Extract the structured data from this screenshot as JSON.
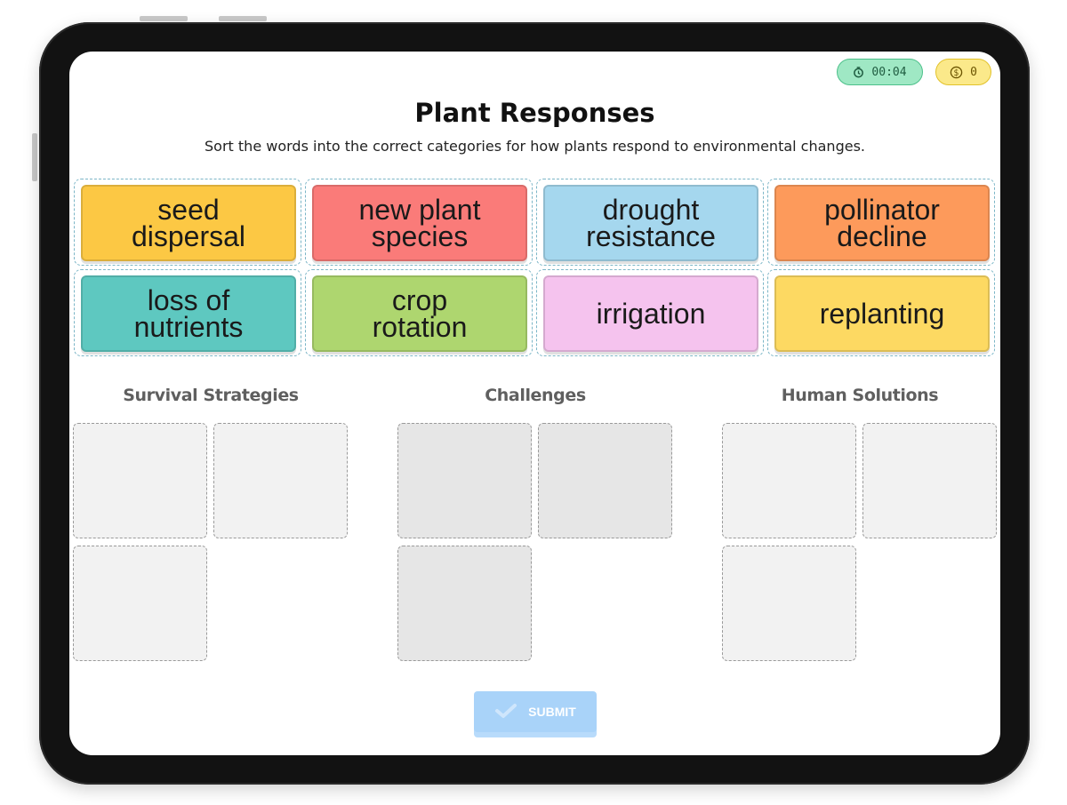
{
  "status": {
    "timer": "00:04",
    "coins": "0",
    "timer_icon": "timer-icon",
    "coin_icon": "dollar-coin-icon"
  },
  "header": {
    "title": "Plant Responses",
    "subtitle": "Sort the words into the correct categories for how plants respond to environmental changes."
  },
  "word_bank": [
    {
      "line1": "seed",
      "line2": "dispersal",
      "color": "#fcc844"
    },
    {
      "line1": "new plant",
      "line2": "species",
      "color": "#fa7b79"
    },
    {
      "line1": "drought",
      "line2": "resistance",
      "color": "#a5d7ee"
    },
    {
      "line1": "pollinator",
      "line2": "decline",
      "color": "#fd9a5b"
    },
    {
      "line1": "loss of",
      "line2": "nutrients",
      "color": "#5ec8c0"
    },
    {
      "line1": "crop",
      "line2": "rotation",
      "color": "#aed66f"
    },
    {
      "line1": "irrigation",
      "line2": "",
      "color": "#f5c3ee"
    },
    {
      "line1": "replanting",
      "line2": "",
      "color": "#fdd962"
    }
  ],
  "categories": [
    {
      "title": "Survival Strategies"
    },
    {
      "title": "Challenges"
    },
    {
      "title": "Human Solutions"
    }
  ],
  "submit": {
    "label": "SUBMIT",
    "icon": "checkmark-icon",
    "color": "#a9d3f9"
  }
}
